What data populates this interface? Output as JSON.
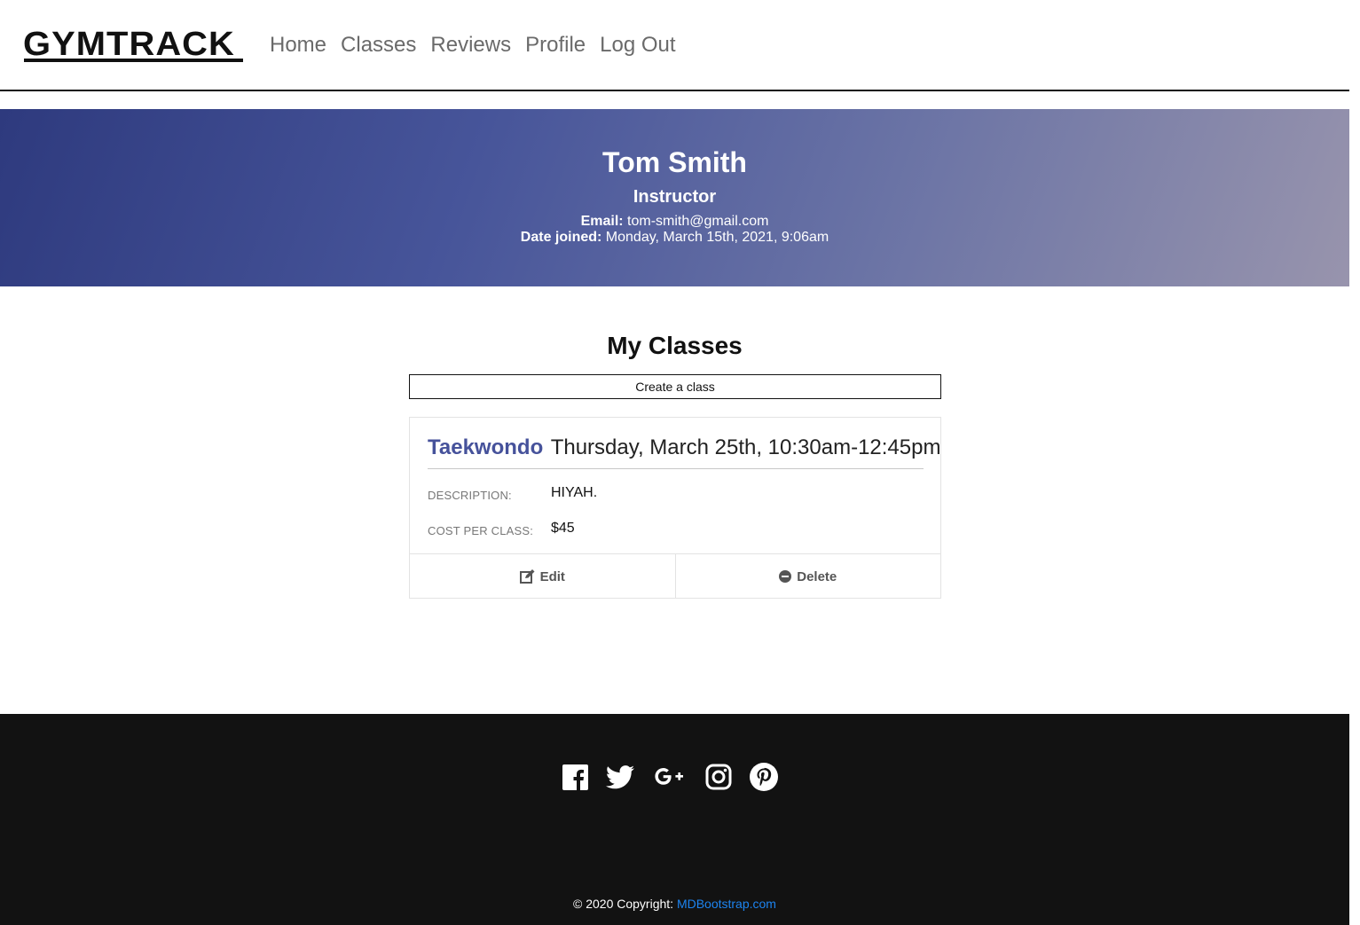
{
  "nav": {
    "logo": "GYMTRACK",
    "links": [
      "Home",
      "Classes",
      "Reviews",
      "Profile",
      "Log Out"
    ]
  },
  "profile": {
    "name": "Tom Smith",
    "role": "Instructor",
    "email_label": "Email:",
    "email": "tom-smith@gmail.com",
    "joined_label": "Date joined:",
    "joined": "Monday, March 15th, 2021, 9:06am"
  },
  "classes": {
    "title": "My Classes",
    "create_label": "Create a class",
    "items": [
      {
        "name": "Taekwondo",
        "time": "Thursday, March 25th, 10:30am-12:45pm",
        "description_label": "Description:",
        "description": "HIYAH.",
        "cost_label": "Cost per class:",
        "cost": "$45",
        "edit_label": "Edit",
        "delete_label": "Delete"
      }
    ]
  },
  "footer": {
    "socials": [
      "facebook-icon",
      "twitter-icon",
      "google-plus-icon",
      "instagram-icon",
      "pinterest-icon"
    ],
    "copyright_prefix": "© 2020 Copyright:",
    "copyright_link": "MDBootstrap.com"
  },
  "colors": {
    "accent": "#46529b",
    "hero_start": "#2e3a7e",
    "hero_end": "#9894ad",
    "footer_bg": "#121212",
    "link": "#1d84f0"
  }
}
